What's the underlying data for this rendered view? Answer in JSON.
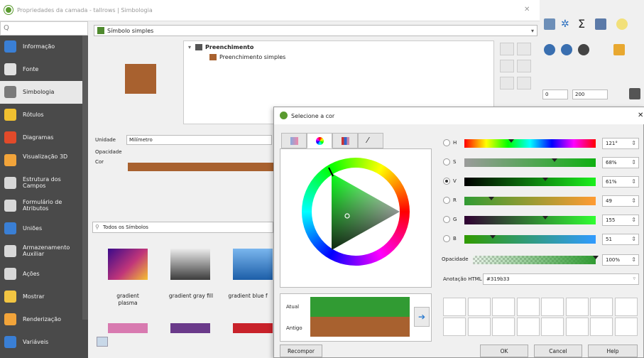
{
  "window": {
    "title": "Propriedades da camada - tallrows | Simbologia"
  },
  "search": {
    "placeholder": "Q"
  },
  "sidebar": {
    "items": [
      {
        "label": "Informação",
        "icon": "info-icon",
        "color": "#3a7fd5"
      },
      {
        "label": "Fonte",
        "icon": "source-icon",
        "color": "#e0e0e0"
      },
      {
        "label": "Simbologia",
        "icon": "symbology-icon",
        "color": "#7a7a7a"
      },
      {
        "label": "Rótulos",
        "icon": "labels-icon",
        "color": "#f0c030"
      },
      {
        "label": "Diagramas",
        "icon": "diagram-icon",
        "color": "#e24a2a"
      },
      {
        "label": "Visualização 3D",
        "icon": "cube-icon",
        "color": "#f2a43a"
      },
      {
        "label": "Estrutura dos Campos",
        "icon": "table-icon",
        "color": "#d8d8d8"
      },
      {
        "label": "Formulário de Atributos",
        "icon": "form-icon",
        "color": "#d8d8d8"
      },
      {
        "label": "Uniões",
        "icon": "join-icon",
        "color": "#3a7fd5"
      },
      {
        "label": "Armazenamento Auxiliar",
        "icon": "storage-icon",
        "color": "#d8d8d8"
      },
      {
        "label": "Ações",
        "icon": "gear-icon",
        "color": "#d8d8d8"
      },
      {
        "label": "Mostrar",
        "icon": "speech-icon",
        "color": "#f2c542"
      },
      {
        "label": "Renderização",
        "icon": "brush-icon",
        "color": "#f2a43a"
      },
      {
        "label": "Variáveis",
        "icon": "variables-icon",
        "color": "#3a7fd5"
      }
    ]
  },
  "symbol": {
    "type_label": "Símbolo simples",
    "tree_root": "Preenchimento",
    "tree_child": "Preenchimento simples",
    "color": "#a8612f"
  },
  "props": {
    "unit_label": "Unidade",
    "unit_value": "Milímetro",
    "opacity_label": "Opacidade",
    "color_label": "Cor"
  },
  "toolbar": {
    "spin1": "0",
    "spin2": "200"
  },
  "library": {
    "search_placeholder": "Todos os Símbolos",
    "items": [
      {
        "label": "gradient plasma"
      },
      {
        "label": "gradient gray fill"
      },
      {
        "label": "gradient blue f"
      }
    ]
  },
  "dialog": {
    "title": "Selecione a cor",
    "sliders": [
      {
        "label": "H",
        "value": "121°",
        "checked": false,
        "pos": 0.34
      },
      {
        "label": "S",
        "value": "68%",
        "checked": false,
        "pos": 0.68
      },
      {
        "label": "V",
        "value": "61%",
        "checked": true,
        "pos": 0.61
      },
      {
        "label": "R",
        "value": "49",
        "checked": false,
        "pos": 0.19
      },
      {
        "label": "G",
        "value": "155",
        "checked": false,
        "pos": 0.61
      },
      {
        "label": "B",
        "value": "51",
        "checked": false,
        "pos": 0.2
      }
    ],
    "opacity_label": "Opacidade",
    "opacity_value": "100%",
    "html_label": "Anotação HTML",
    "html_value": "#319b33",
    "current_label": "Atual",
    "old_label": "Antigo",
    "current_color": "#319b33",
    "old_color": "#a8612f",
    "reset_label": "Recompor",
    "ok_label": "OK",
    "cancel_label": "Cancel",
    "help_label": "Help"
  }
}
